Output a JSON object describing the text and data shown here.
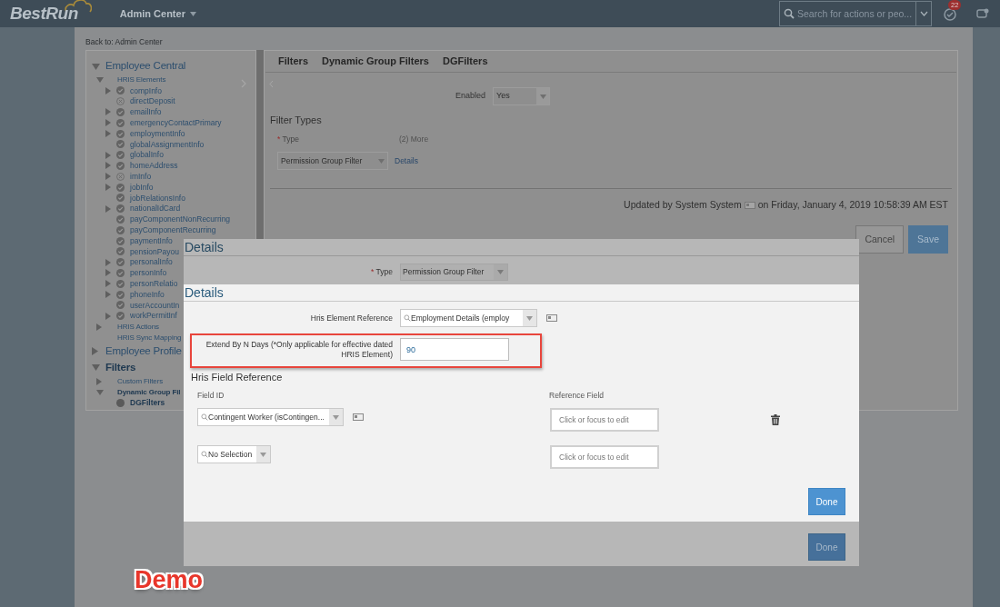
{
  "top_bar": {
    "logo": "BestRun",
    "app_menu": "Admin Center",
    "search": {
      "placeholder": "Search for actions or peo..."
    },
    "notification_count": "22"
  },
  "back_link": "Back to: Admin Center",
  "tree": [
    {
      "label": "Employee Central",
      "expanded": true,
      "selected": false,
      "children": [
        {
          "label": "HRIS Elements",
          "expanded": true,
          "selected": false,
          "children": [
            {
              "label": "compInfo",
              "expanded": false,
              "kind": "check",
              "selected": false
            },
            {
              "label": "directDeposit",
              "kind": "error",
              "selected": false
            },
            {
              "label": "emailInfo",
              "expanded": false,
              "kind": "check",
              "selected": false
            },
            {
              "label": "emergencyContactPrimary",
              "expanded": false,
              "kind": "check",
              "selected": false
            },
            {
              "label": "employmentInfo",
              "expanded": false,
              "kind": "check",
              "selected": false
            },
            {
              "label": "globalAssignmentInfo",
              "kind": "check",
              "selected": false
            },
            {
              "label": "globalInfo",
              "expanded": false,
              "kind": "check",
              "selected": false
            },
            {
              "label": "homeAddress",
              "expanded": false,
              "kind": "check",
              "selected": false
            },
            {
              "label": "imInfo",
              "expanded": false,
              "kind": "error",
              "selected": false
            },
            {
              "label": "jobInfo",
              "expanded": false,
              "kind": "check",
              "selected": false
            },
            {
              "label": "jobRelationsInfo",
              "kind": "check",
              "selected": false
            },
            {
              "label": "nationalIdCard",
              "expanded": false,
              "kind": "check",
              "selected": false
            },
            {
              "label": "payComponentNonRecurring",
              "kind": "check",
              "selected": false
            },
            {
              "label": "payComponentRecurring",
              "kind": "check",
              "selected": false
            },
            {
              "label": "paymentInfo",
              "kind": "check",
              "selected": false
            },
            {
              "label": "pensionPayou",
              "kind": "check",
              "selected": false
            },
            {
              "label": "personalInfo",
              "expanded": false,
              "kind": "check",
              "selected": false
            },
            {
              "label": "personInfo",
              "expanded": false,
              "kind": "check",
              "selected": false
            },
            {
              "label": "personRelatio",
              "expanded": false,
              "kind": "check",
              "selected": false
            },
            {
              "label": "phoneInfo",
              "expanded": false,
              "kind": "check",
              "selected": false
            },
            {
              "label": "userAccountIn",
              "kind": "check",
              "selected": false
            },
            {
              "label": "workPermitInf",
              "expanded": false,
              "kind": "check",
              "selected": false
            }
          ]
        },
        {
          "label": "HRIS Actions",
          "expanded": false,
          "selected": false
        },
        {
          "label": "HRIS Sync Mapping",
          "selected": false
        }
      ]
    },
    {
      "label": "Employee Profile",
      "expanded": false,
      "selected": false
    },
    {
      "label": "Filters",
      "expanded": true,
      "selected": true,
      "children": [
        {
          "label": "Custom Filters",
          "expanded": false,
          "selected": false
        },
        {
          "label": "Dynamic Group Fil",
          "expanded": true,
          "selected": true,
          "children": [
            {
              "label": "DGFilters",
              "kind": "dot",
              "selected": true
            }
          ]
        }
      ]
    }
  ],
  "breadcrumbs": [
    "Filters",
    "Dynamic Group Filters",
    "DGFilters"
  ],
  "enabled": {
    "label": "Enabled",
    "value": "Yes"
  },
  "filter_types": {
    "title": "Filter Types",
    "type_label": "Type",
    "required_mark": "*",
    "more": "(2) More",
    "value": "Permission Group Filter",
    "details_link": "Details"
  },
  "updated": {
    "before": "Updated by System System",
    "after": "on Friday, January 4, 2019 10:58:39 AM EST"
  },
  "buttons": [
    {
      "label": "Cancel",
      "kind": "secondary"
    },
    {
      "label": "Save",
      "kind": "primary"
    }
  ],
  "outer_dialog": {
    "title": "Details",
    "type_field": {
      "label": "Type",
      "required_mark": "*",
      "value": "Permission Group Filter"
    },
    "done": "Done"
  },
  "inner_dialog": {
    "title": "Details",
    "hris_element_reference": {
      "label": "Hris Element Reference",
      "value": "Employment Details (employ"
    },
    "extend_days": {
      "label": "Extend By N Days (*Only applicable for effective dated HRIS Element)",
      "value": "90",
      "highlighted": true
    },
    "field_reference": {
      "title": "Hris Field Reference",
      "columns": [
        "Field ID",
        "Reference Field"
      ],
      "rows": [
        {
          "field_id": "Contingent Worker (isContingen...",
          "reference_placeholder": "Click or focus to edit",
          "details_icon": true,
          "removable": true
        },
        {
          "field_id": "No Selection",
          "reference_placeholder": "Click or focus to edit",
          "details_icon": false,
          "removable": false
        }
      ]
    },
    "done": "Done"
  },
  "annotation": "Demo"
}
